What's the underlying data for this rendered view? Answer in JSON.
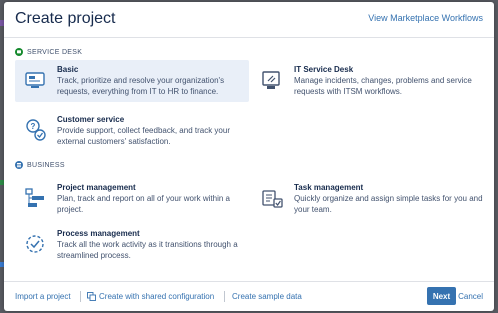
{
  "dialog": {
    "title": "Create project",
    "marketplace_link": "View Marketplace Workflows"
  },
  "sections": [
    {
      "label": "SERVICE DESK",
      "color": "#14892c",
      "options": [
        {
          "title": "Basic",
          "description": "Track, prioritize and resolve your organization's requests, everything from IT to HR to finance.",
          "icon": "service-desk-basic-icon",
          "selected": true
        },
        {
          "title": "IT Service Desk",
          "description": "Manage incidents, changes, problems and service requests with ITSM workflows.",
          "icon": "it-service-desk-icon"
        },
        {
          "title": "Customer service",
          "description": "Provide support, collect feedback, and track your external customers' satisfaction.",
          "icon": "customer-service-icon"
        }
      ]
    },
    {
      "label": "BUSINESS",
      "color": "#3572b0",
      "options": [
        {
          "title": "Project management",
          "description": "Plan, track and report on all of your work within a project.",
          "icon": "project-management-icon"
        },
        {
          "title": "Task management",
          "description": "Quickly organize and assign simple tasks for you and your team.",
          "icon": "task-management-icon"
        },
        {
          "title": "Process management",
          "description": "Track all the work activity as it transitions through a streamlined process.",
          "icon": "process-management-icon"
        }
      ]
    }
  ],
  "footer": {
    "import_link": "Import a project",
    "shared_config_link": "Create with shared configuration",
    "sample_data_link": "Create sample data",
    "next_button": "Next",
    "cancel_link": "Cancel"
  },
  "colors": {
    "accent": "#3572b0",
    "selected_bg": "#e9eff8"
  }
}
